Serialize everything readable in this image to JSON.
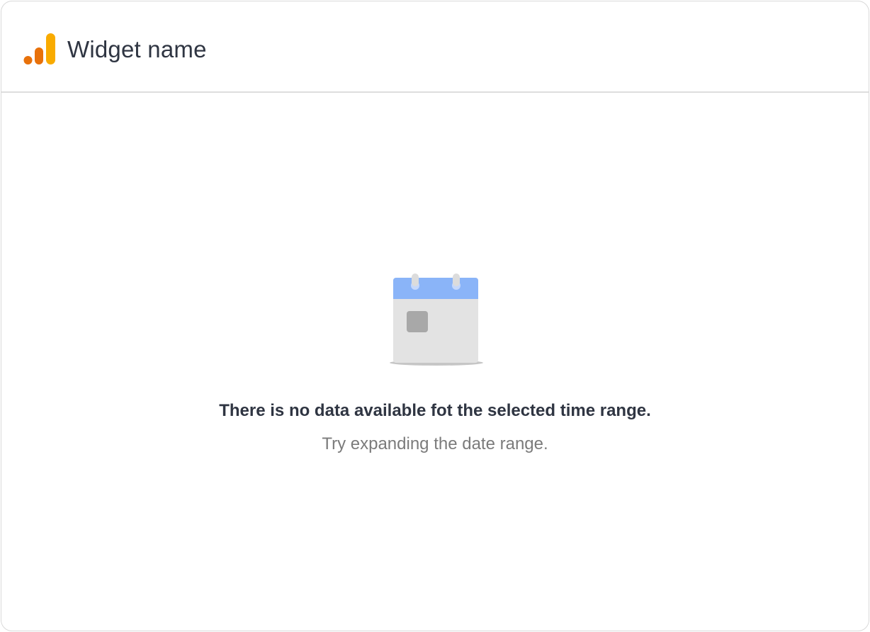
{
  "widget": {
    "title": "Widget name",
    "logo_icon": "analytics-bars-icon"
  },
  "empty_state": {
    "icon": "calendar-icon",
    "title": "There is no data available fot the selected time range.",
    "subtitle": "Try expanding the date range."
  },
  "colors": {
    "logo_dark_orange": "#e8710a",
    "logo_orange": "#f9ab00",
    "calendar_header": "#8ab4f8",
    "calendar_body": "#e3e3e3",
    "calendar_day": "#a8a8a8",
    "calendar_rings": "#dcdcdc",
    "text_primary": "#2f3542",
    "text_secondary": "#7b7b7b"
  }
}
